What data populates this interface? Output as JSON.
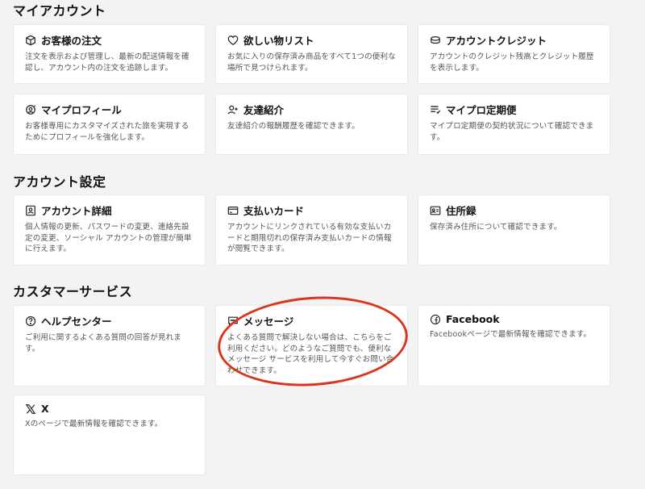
{
  "sections": {
    "my_account": {
      "title": "マイアカウント",
      "cards": [
        {
          "icon": "box-icon",
          "title": "お客様の注文",
          "desc": "注文を表示および管理し、最新の配送情報を確認し、アカウント内の注文を追跡します。"
        },
        {
          "icon": "heart-icon",
          "title": "欲しい物リスト",
          "desc": "お気に入りの保存済み商品をすべて1つの便利な場所で見つけられます。"
        },
        {
          "icon": "coin-stack-icon",
          "title": "アカウントクレジット",
          "desc": "アカウントのクレジット残高とクレジット履歴を表示します。"
        },
        {
          "icon": "profile-settings-icon",
          "title": "マイプロフィール",
          "desc": "お客様専用にカスタマイズされた旅を実現するためにプロフィールを強化します。"
        },
        {
          "icon": "user-plus-icon",
          "title": "友達紹介",
          "desc": "友達紹介の報酬履歴を確認できます。"
        },
        {
          "icon": "list-icon",
          "title": "マイプロ定期便",
          "desc": "マイプロ定期便の契約状況について確認できます。"
        }
      ]
    },
    "account_settings": {
      "title": "アカウント設定",
      "cards": [
        {
          "icon": "portrait-icon",
          "title": "アカウント詳細",
          "desc": "個人情報の更新、パスワードの変更、連絡先設定の変更、ソーシャル アカウントの管理が簡単に行えます。"
        },
        {
          "icon": "credit-card-icon",
          "title": "支払いカード",
          "desc": "アカウントにリンクされている有効な支払いカードと期限切れの保存済み支払いカードの情報が閲覧できます。"
        },
        {
          "icon": "address-card-icon",
          "title": "住所録",
          "desc": "保存済み住所について確認できます。"
        }
      ]
    },
    "customer_service": {
      "title": "カスタマーサービス",
      "cards": [
        {
          "icon": "help-circle-icon",
          "title": "ヘルプセンター",
          "desc": "ご利用に関するよくある質問の回答が見れます。"
        },
        {
          "icon": "message-icon",
          "title": "メッセージ",
          "desc": "よくある質問で解決しない場合は、こちらをご利用ください。どのようなご質問でも、便利なメッセージ サービスを利用して今すぐお問い合わせできます。"
        },
        {
          "icon": "facebook-icon",
          "title": "Facebook",
          "desc": "Facebookページで最新情報を確認できます。"
        },
        {
          "icon": "x-logo-icon",
          "title": "X",
          "desc": "Xのページで最新情報を確認できます。"
        }
      ]
    }
  },
  "annotation_color": "#d9361f"
}
